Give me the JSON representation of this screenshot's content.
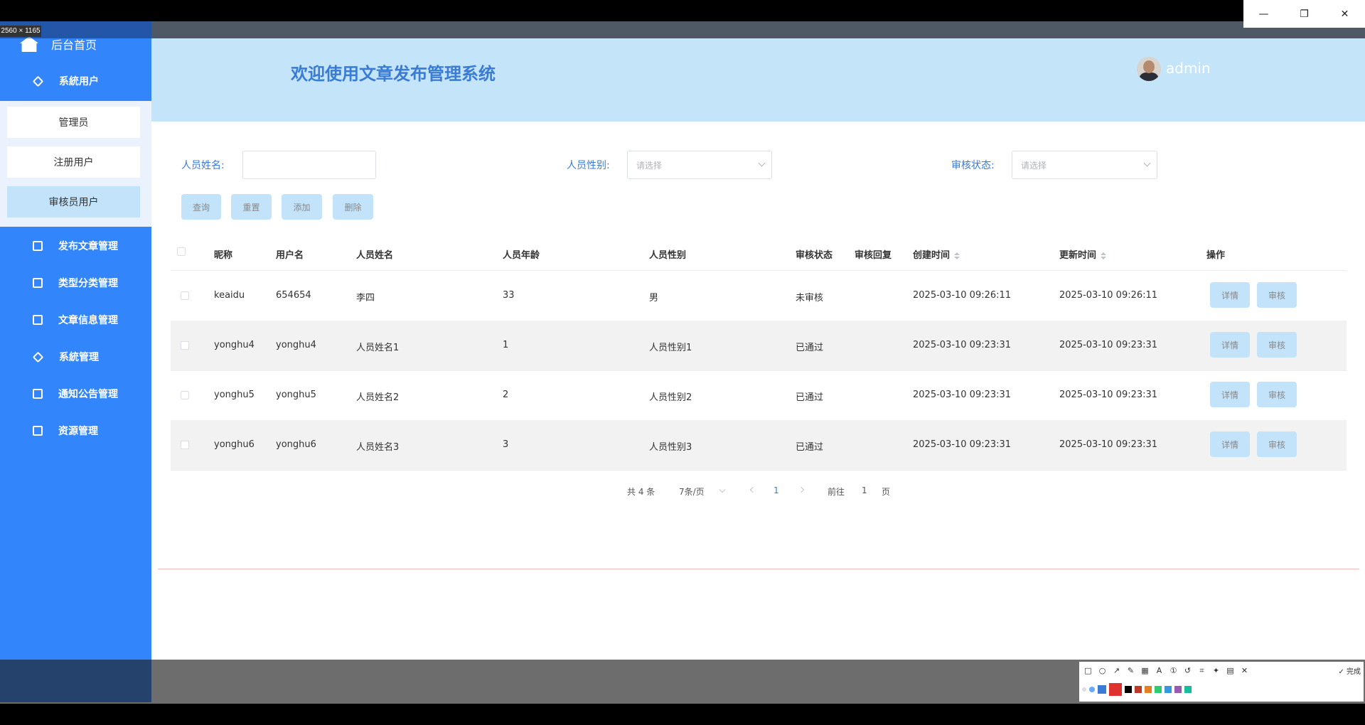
{
  "window": {
    "size_label": "2560 × 1165",
    "min_icon": "minimize-icon",
    "max_icon": "maximize-icon",
    "close_icon": "close-icon"
  },
  "sidebar": {
    "home_label": "后台首页",
    "items": [
      {
        "label": "系統用户",
        "icon": "diamond-icon"
      },
      {
        "label": "发布文章管理",
        "icon": "edit-icon"
      },
      {
        "label": "类型分类管理",
        "icon": "chart-icon"
      },
      {
        "label": "文章信息管理",
        "icon": "edit-icon"
      },
      {
        "label": "系統管理",
        "icon": "diamond-icon"
      },
      {
        "label": "通知公告管理",
        "icon": "chart-icon"
      },
      {
        "label": "资源管理",
        "icon": "media-icon"
      }
    ],
    "subitems": [
      {
        "label": "管理员"
      },
      {
        "label": "注册用户"
      },
      {
        "label": "审核员用户"
      }
    ]
  },
  "header": {
    "title": "欢迎使用文章发布管理系统",
    "username": "admin"
  },
  "filters": {
    "name_label": "人员姓名:",
    "gender_label": "人员性别:",
    "gender_placeholder": "请选择",
    "status_label": "审核状态:",
    "status_placeholder": "请选择"
  },
  "buttons": {
    "query": "查询",
    "reset": "重置",
    "add": "添加",
    "delete": "删除"
  },
  "table": {
    "headers": [
      "昵称",
      "用户名",
      "人员姓名",
      "人员年龄",
      "人员性别",
      "审核状态",
      "审核回复",
      "创建时间",
      "更新时间",
      "操作"
    ],
    "rows": [
      {
        "nickname": "keaidu",
        "username": "654654",
        "name": "李四",
        "age": "33",
        "gender": "男",
        "status": "未审核",
        "reply": "",
        "created": "2025-03-10 09:26:11",
        "updated": "2025-03-10 09:26:11"
      },
      {
        "nickname": "yonghu4",
        "username": "yonghu4",
        "name": "人员姓名1",
        "age": "1",
        "gender": "人员性别1",
        "status": "已通过",
        "reply": "",
        "created": "2025-03-10 09:23:31",
        "updated": "2025-03-10 09:23:31"
      },
      {
        "nickname": "yonghu5",
        "username": "yonghu5",
        "name": "人员姓名2",
        "age": "2",
        "gender": "人员性别2",
        "status": "已通过",
        "reply": "",
        "created": "2025-03-10 09:23:31",
        "updated": "2025-03-10 09:23:31"
      },
      {
        "nickname": "yonghu6",
        "username": "yonghu6",
        "name": "人员姓名3",
        "age": "3",
        "gender": "人员性别3",
        "status": "已通过",
        "reply": "",
        "created": "2025-03-10 09:23:31",
        "updated": "2025-03-10 09:23:31"
      }
    ],
    "detail_label": "详情",
    "audit_label": "审核"
  },
  "pagination": {
    "total": "共 4 条",
    "page_size": "7条/页",
    "current_page": "1",
    "goto_prefix": "前往",
    "goto_value": "1",
    "goto_suffix": "页"
  },
  "toolbar": {
    "done_label": "完成"
  },
  "colors": {
    "sidebar": "#3385fc",
    "header": "#c3e4f9",
    "accent": "#3a7bd5",
    "button": "#c3e3fa"
  }
}
